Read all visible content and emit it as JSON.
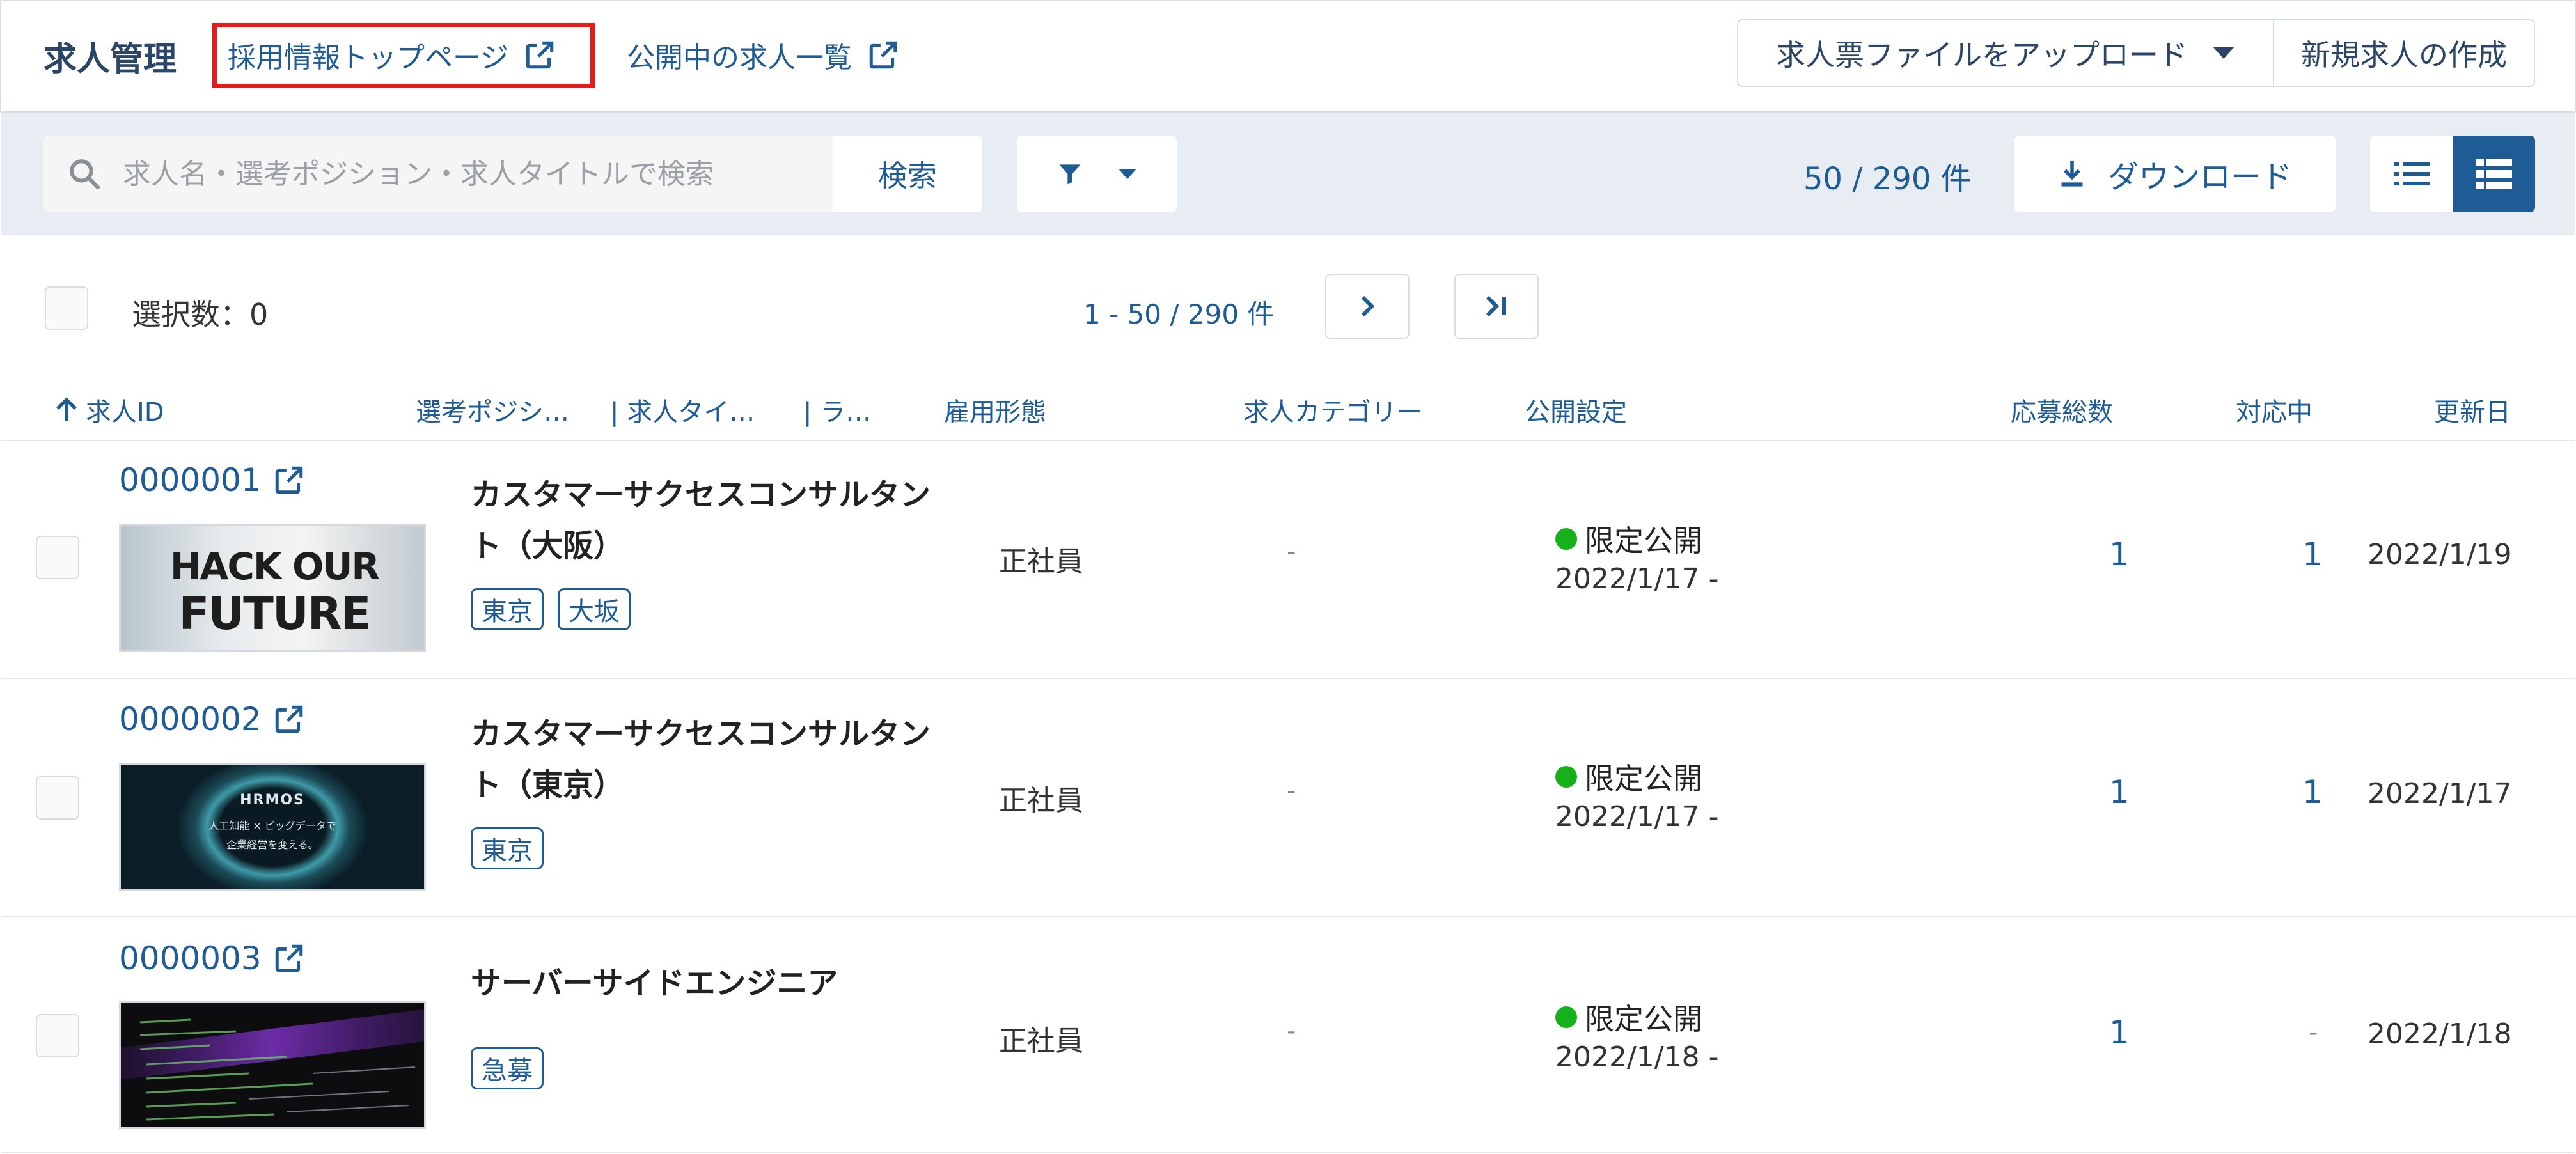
{
  "header": {
    "app_title": "求人管理",
    "top_page_link": "採用情報トップページ",
    "published_list_link": "公開中の求人一覧",
    "upload_button": "求人票ファイルをアップロード",
    "new_job_button": "新規求人の作成"
  },
  "toolbar": {
    "search_placeholder": "求人名・選考ポジション・求人タイトルで検索",
    "search_button": "検索",
    "result_count": "50 / 290 件",
    "download_button": "ダウンロード"
  },
  "list": {
    "selected_count": "選択数：0",
    "range": "1 - 50 / 290 件"
  },
  "columns": {
    "id": "求人ID",
    "position": "選考ポジシ…",
    "title": "| 求人タイ…",
    "label": "| ラ…",
    "employment": "雇用形態",
    "category": "求人カテゴリー",
    "publish": "公開設定",
    "applications": "応募総数",
    "in_progress": "対応中",
    "updated": "更新日"
  },
  "rows": [
    {
      "id": "0000001",
      "title_line1": "カスタマーサクセスコンサルタン",
      "title_line2": "ト（大阪）",
      "tags": [
        "東京",
        "大坂"
      ],
      "thumb_text_1": "HACK OUR",
      "thumb_text_2": "FUTURE",
      "employment": "正社員",
      "category": "-",
      "status": "限定公開",
      "status_date": "2022/1/17 -",
      "applications": "1",
      "in_progress": "1",
      "updated": "2022/1/19"
    },
    {
      "id": "0000002",
      "title_line1": "カスタマーサクセスコンサルタン",
      "title_line2": "ト（東京）",
      "tags": [
        "東京"
      ],
      "thumb_text_1": "HRMOS",
      "thumb_text_2": "人工知能 × ビッグデータで",
      "thumb_text_3": "企業経営を変える。",
      "employment": "正社員",
      "category": "-",
      "status": "限定公開",
      "status_date": "2022/1/17 -",
      "applications": "1",
      "in_progress": "1",
      "updated": "2022/1/17"
    },
    {
      "id": "0000003",
      "title_line1": "サーバーサイドエンジニア",
      "title_line2": "",
      "tags": [
        "急募"
      ],
      "employment": "正社員",
      "category": "-",
      "status": "限定公開",
      "status_date": "2022/1/18 -",
      "applications": "1",
      "in_progress": "-",
      "updated": "2022/1/18"
    }
  ],
  "colors": {
    "accent": "#1f5b95",
    "highlight_border": "#e01c1c",
    "status_green": "#16b01a",
    "toolbar_bg": "#e7edf2"
  }
}
